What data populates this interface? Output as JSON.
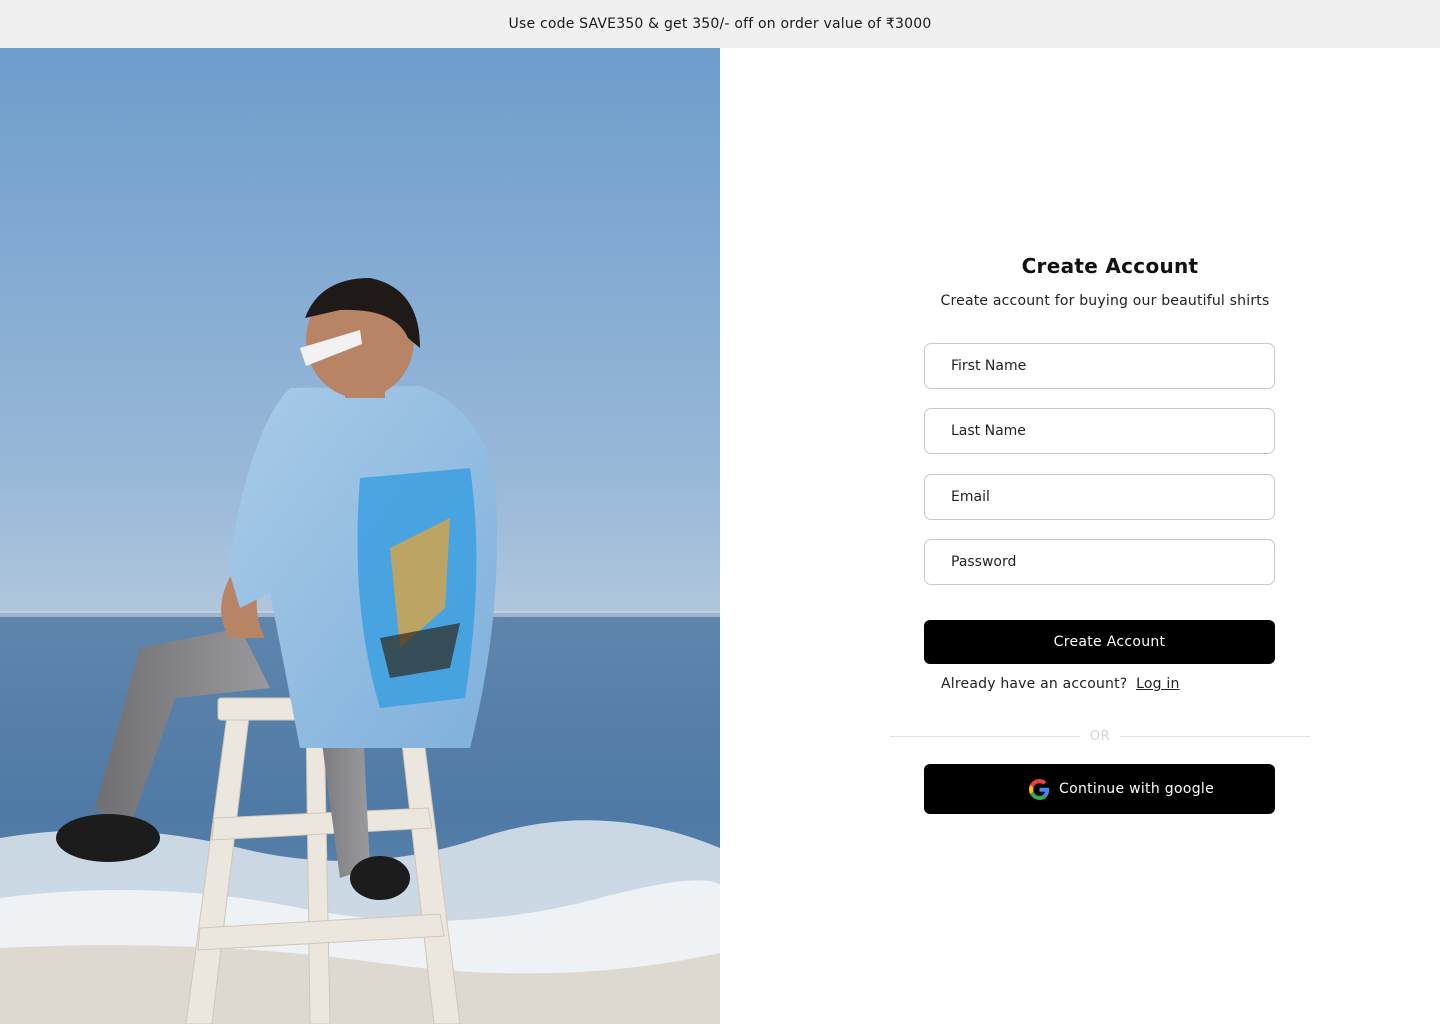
{
  "promo": {
    "text": "Use code SAVE350 & get 350/- off on order value of ₹3000"
  },
  "hero": {
    "image_description_icon": "hero-photo"
  },
  "form": {
    "title": "Create Account",
    "subtitle": "Create account for buying our beautiful shirts",
    "first_name_placeholder": "First Name",
    "last_name_placeholder": "Last Name",
    "email_placeholder": "Email",
    "password_placeholder": "Password",
    "submit_label": "Create Account",
    "login_prompt": "Already have an account?",
    "login_link": "Log in",
    "divider_label": "OR",
    "google_label": "Continue with google",
    "google_icon": "google-icon"
  },
  "colors": {
    "button_bg": "#000000",
    "promo_bg": "#f0f0f0",
    "field_border": "#c9c9c9"
  }
}
